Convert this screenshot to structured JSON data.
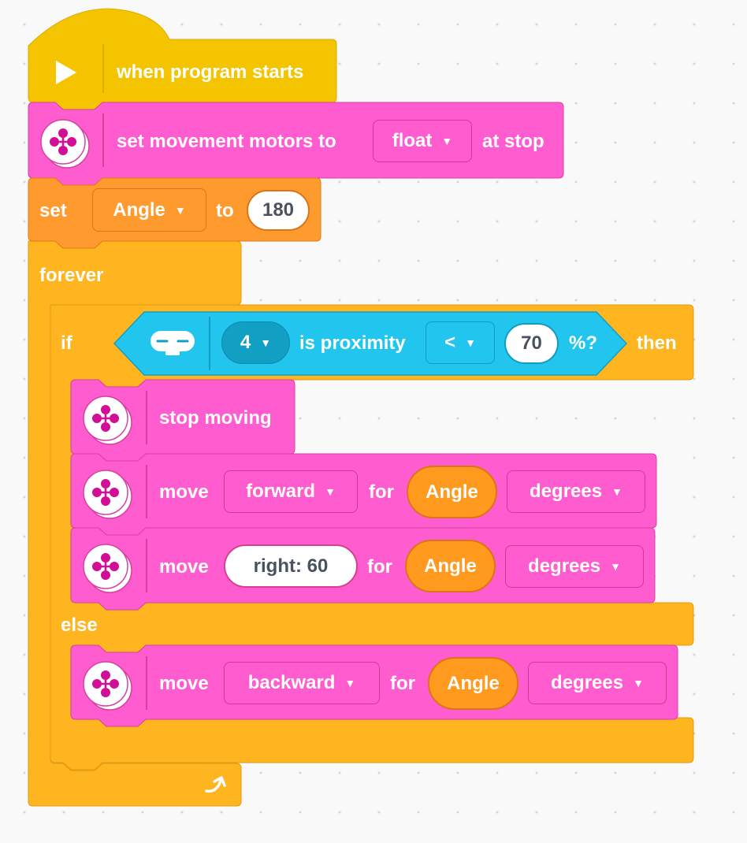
{
  "colors": {
    "event": "#f5c400",
    "motors": "#ff5ccf",
    "variables": "#ff9a2e",
    "control": "#ffb51f",
    "sensors": "#21c5ee",
    "reporter": "#ff9a1f"
  },
  "icons": {
    "start": "play-icon",
    "motor": "movement-motors-icon",
    "sensor": "distance-sensor-icon",
    "loop": "loop-arrow-icon",
    "dropdown": "chevron-down-icon"
  },
  "hat": {
    "label": "when program starts"
  },
  "set_stop": {
    "label": "set movement motors to",
    "mode": "float",
    "suffix": "at stop"
  },
  "set_var": {
    "set_label": "set",
    "variable": "Angle",
    "to_label": "to",
    "value": "180"
  },
  "forever": {
    "label": "forever"
  },
  "if_block": {
    "if_label": "if",
    "port": "4",
    "is_label": "is proximity",
    "operator": "<",
    "value": "70",
    "unit": "%?",
    "then_label": "then",
    "else_label": "else"
  },
  "stop_moving": {
    "label": "stop moving"
  },
  "move1": {
    "move_label": "move",
    "direction": "forward",
    "for_label": "for",
    "amount": "Angle",
    "unit": "degrees"
  },
  "move2": {
    "move_label": "move",
    "steering": "right: 60",
    "for_label": "for",
    "amount": "Angle",
    "unit": "degrees"
  },
  "move3": {
    "move_label": "move",
    "direction": "backward",
    "for_label": "for",
    "amount": "Angle",
    "unit": "degrees"
  }
}
